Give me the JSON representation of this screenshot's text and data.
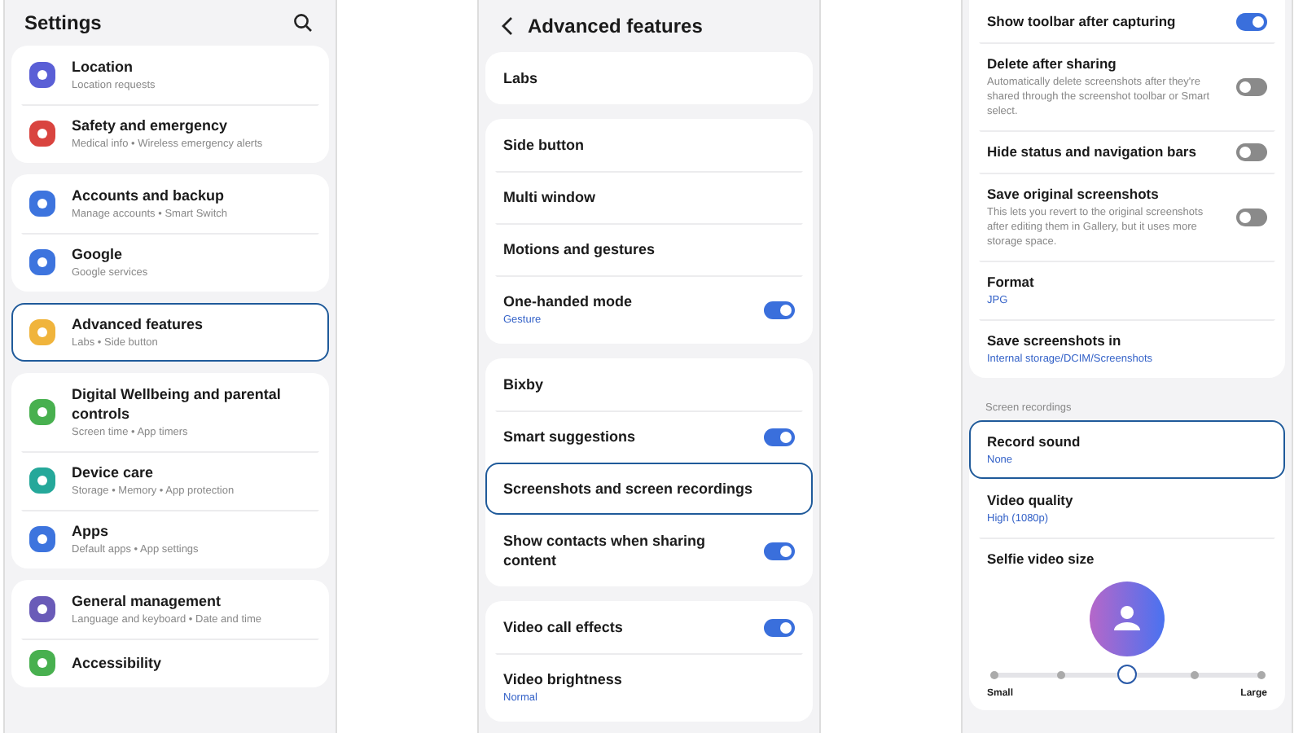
{
  "screens": [
    {
      "header": {
        "kind": "top",
        "title": "Settings"
      },
      "groups": [
        {
          "items": [
            {
              "kind": "row",
              "title": "Location",
              "subtitle": "Location requests",
              "color": "#5a5fd6",
              "selected": false
            },
            {
              "kind": "row",
              "title": "Safety and emergency",
              "subtitle": "Medical info • Wireless emergency alerts",
              "color": "#d9443f",
              "selected": false
            }
          ]
        },
        {
          "items": [
            {
              "kind": "row",
              "title": "Accounts and backup",
              "subtitle": "Manage accounts • Smart Switch",
              "color": "#3d74de",
              "selected": false
            },
            {
              "kind": "row",
              "title": "Google",
              "subtitle": "Google services",
              "color": "#3d74de",
              "selected": false
            }
          ]
        },
        {
          "items": [
            {
              "kind": "row",
              "title": "Advanced features",
              "subtitle": "Labs • Side button",
              "color": "#f0b43c",
              "selected": true
            }
          ]
        },
        {
          "items": [
            {
              "kind": "row",
              "title": "Digital Wellbeing and parental controls",
              "subtitle": "Screen time • App timers",
              "color": "#48b04f",
              "selected": false
            },
            {
              "kind": "row",
              "title": "Device care",
              "subtitle": "Storage • Memory • App protection",
              "color": "#25a89a",
              "selected": false
            },
            {
              "kind": "row",
              "title": "Apps",
              "subtitle": "Default apps • App settings",
              "color": "#3d74de",
              "selected": false
            }
          ]
        },
        {
          "items": [
            {
              "kind": "row",
              "title": "General management",
              "subtitle": "Language and keyboard • Date and time",
              "color": "#6a5bb8",
              "selected": false
            },
            {
              "kind": "row",
              "title": "Accessibility",
              "color": "#48b04f",
              "selected": false
            }
          ]
        }
      ]
    },
    {
      "header": {
        "kind": "sub",
        "title": "Advanced features"
      },
      "groups": [
        {
          "items": [
            {
              "kind": "row",
              "title": "Labs",
              "selected": false
            }
          ]
        },
        {
          "items": [
            {
              "kind": "row",
              "title": "Side button",
              "selected": false
            },
            {
              "kind": "row",
              "title": "Multi window",
              "selected": false
            },
            {
              "kind": "row",
              "title": "Motions and gestures",
              "selected": false
            },
            {
              "kind": "row",
              "title": "One-handed mode",
              "value": "Gesture",
              "on": true,
              "selected": false
            }
          ]
        },
        {
          "items": [
            {
              "kind": "row",
              "title": "Bixby",
              "selected": false
            },
            {
              "kind": "row",
              "title": "Smart suggestions",
              "on": true,
              "selected": false
            },
            {
              "kind": "row",
              "title": "Screenshots and screen recordings",
              "selected": true
            },
            {
              "kind": "row",
              "title": "Show contacts when sharing content",
              "on": true,
              "selected": false
            }
          ]
        },
        {
          "items": [
            {
              "kind": "row",
              "title": "Video call effects",
              "on": true,
              "selected": false
            },
            {
              "kind": "row",
              "title": "Video brightness",
              "value": "Normal",
              "selected": false
            }
          ]
        }
      ]
    },
    {
      "groups": [
        {
          "items": [
            {
              "kind": "row",
              "title": "Show toolbar after capturing",
              "on": true,
              "selected": false
            },
            {
              "kind": "row",
              "title": "Delete after sharing",
              "subtitle": "Automatically delete screenshots after they're shared through the screenshot toolbar or Smart select.",
              "on": false,
              "selected": false
            },
            {
              "kind": "row",
              "title": "Hide status and navigation bars",
              "on": false,
              "selected": false
            },
            {
              "kind": "row",
              "title": "Save original screenshots",
              "subtitle": "This lets you revert to the original screenshots after editing them in Gallery, but it uses more storage space.",
              "on": false,
              "selected": false
            },
            {
              "kind": "row",
              "title": "Format",
              "value": "JPG",
              "selected": false
            },
            {
              "kind": "row",
              "title": "Save screenshots in",
              "value": "Internal storage/DCIM/Screenshots",
              "selected": false
            }
          ]
        },
        {
          "label": "Screen recordings",
          "items": [
            {
              "kind": "row",
              "title": "Record sound",
              "value": "None",
              "selected": true
            },
            {
              "kind": "row",
              "title": "Video quality",
              "value": "High (1080p)",
              "selected": false
            },
            {
              "kind": "selfie",
              "title": "Selfie video size",
              "level": 0.5,
              "min_label": "Small",
              "max_label": "Large",
              "selected": false
            }
          ]
        }
      ]
    }
  ]
}
